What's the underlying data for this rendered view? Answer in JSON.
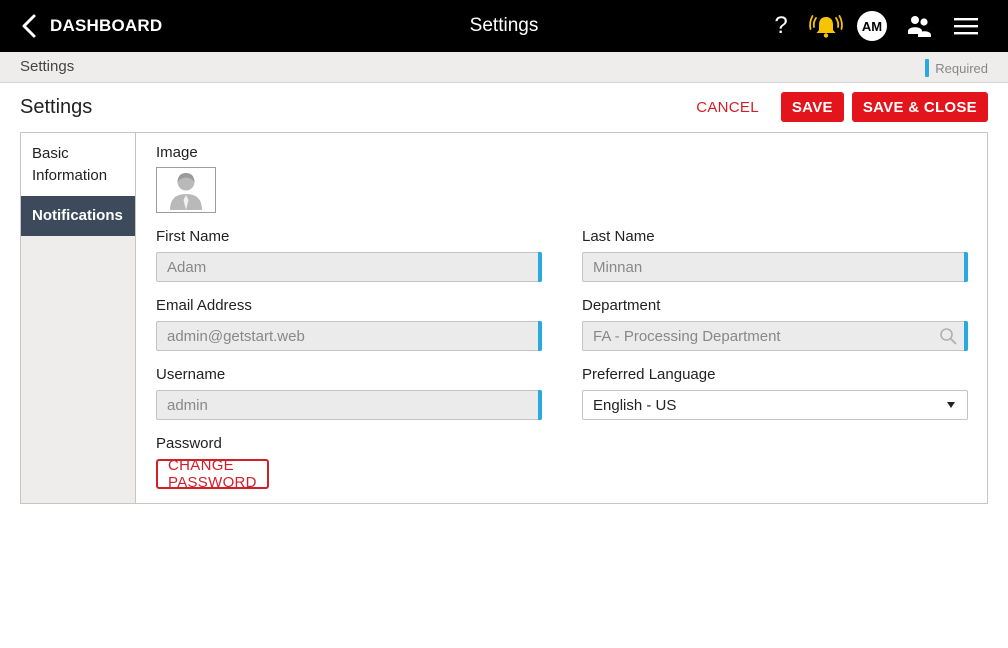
{
  "topbar": {
    "back_label": "DASHBOARD",
    "title": "Settings",
    "help_glyph": "?",
    "avatar_initials": "AM",
    "icons": [
      "chevron-left-icon",
      "help-icon",
      "alert-bell-icon",
      "avatar",
      "users-icon",
      "hamburger-menu-icon"
    ]
  },
  "breadcrumb": {
    "current": "Settings",
    "required_label": "Required"
  },
  "page": {
    "heading": "Settings",
    "cancel_label": "CANCEL",
    "save_label": "SAVE",
    "save_close_label": "SAVE & CLOSE"
  },
  "sidebar": {
    "items": [
      {
        "label_line1": "Basic",
        "label_line2": "Information",
        "active": false
      },
      {
        "label": "Notifications",
        "active": true
      }
    ]
  },
  "form": {
    "image_label": "Image",
    "first_name": {
      "label": "First Name",
      "value": "Adam"
    },
    "last_name": {
      "label": "Last Name",
      "value": "Minnan"
    },
    "email": {
      "label": "Email Address",
      "value": "admin@getstart.web"
    },
    "department": {
      "label": "Department",
      "value": "FA - Processing Department"
    },
    "username": {
      "label": "Username",
      "value": "admin"
    },
    "language": {
      "label": "Preferred Language",
      "value": "English - US"
    },
    "password": {
      "label": "Password",
      "button_label": "CHANGE PASSWORD"
    }
  },
  "colors": {
    "topbar_bg": "#000000",
    "accent_red": "#e3141b",
    "required_blue": "#29a9e0",
    "sidebar_active_bg": "#3c4a5c",
    "crumb_bg": "#efedec"
  }
}
